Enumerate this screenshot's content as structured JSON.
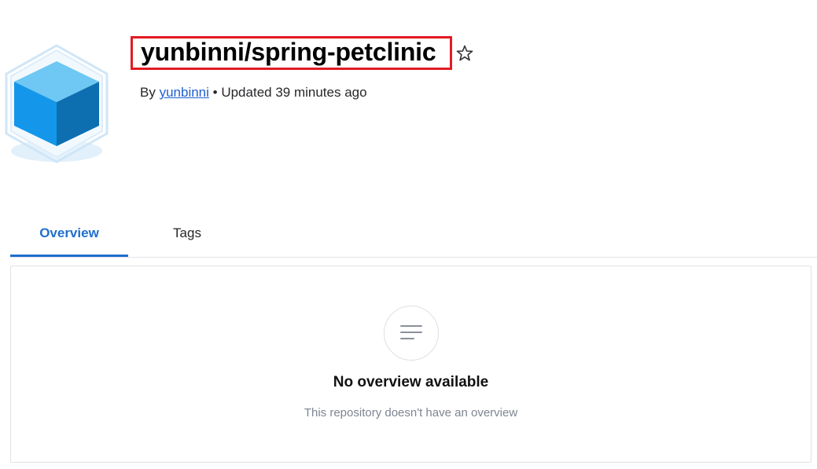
{
  "repo": {
    "title": "yunbinni/spring-petclinic",
    "by_prefix": "By",
    "author": "yunbinni",
    "separator": "•",
    "updated": "Updated 39 minutes ago"
  },
  "tabs": [
    {
      "label": "Overview",
      "active": true
    },
    {
      "label": "Tags",
      "active": false
    }
  ],
  "overview": {
    "empty_title": "No overview available",
    "empty_subtitle": "This repository doesn't have an overview"
  },
  "icons": {
    "logo": "cube-icon",
    "star": "star-icon",
    "overview_empty": "text-lines-icon"
  },
  "colors": {
    "highlight_border": "#e31b23",
    "accent": "#1f6fce",
    "link": "#1f5fd1"
  }
}
